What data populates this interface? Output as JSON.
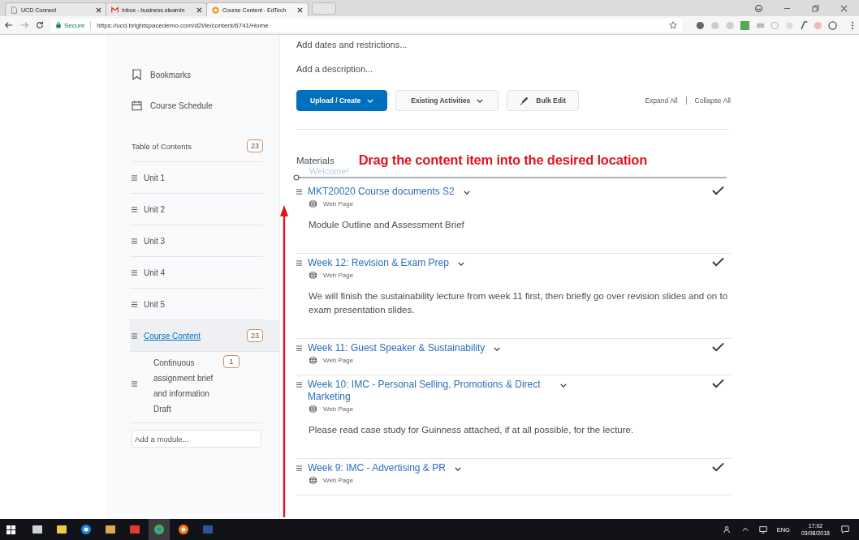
{
  "browser": {
    "tabs": [
      {
        "title": "UCD Connect",
        "kind": "page",
        "selected": false
      },
      {
        "title": "Inbox - business.elearnin",
        "kind": "mail",
        "selected": false
      },
      {
        "title": "Course Content - EdTech",
        "kind": "brightspace",
        "selected": true
      }
    ],
    "secure_label": "Secure",
    "url": "https://ucd.brightspacedemo.com/d2l/le/content/6741/Home"
  },
  "sidebar": {
    "nav": [
      {
        "label": "Bookmarks",
        "kind": "bookmark"
      },
      {
        "label": "Course Schedule",
        "kind": "schedule"
      }
    ],
    "toc": {
      "label": "Table of Contents",
      "count": "23"
    },
    "modules": [
      {
        "label": "Unit 1",
        "selected": false
      },
      {
        "label": "Unit 2",
        "selected": false
      },
      {
        "label": "Unit 3",
        "selected": false
      },
      {
        "label": "Unit 4",
        "selected": false
      },
      {
        "label": "Unit 5",
        "selected": false
      },
      {
        "label": "Course Content",
        "count": "23",
        "selected": true
      },
      {
        "label": "Continuous assignment brief and information Draft",
        "count": "1",
        "selected": false,
        "sub": true
      }
    ],
    "add_module": {
      "placeholder": "Add a module..."
    }
  },
  "main": {
    "dates_link": "Add dates and restrictions...",
    "description_link": "Add a description...",
    "buttons": [
      {
        "label": "Upload / Create",
        "kind": "primary"
      },
      {
        "label": "Existing Activities",
        "kind": "dropdown"
      },
      {
        "label": "Bulk Edit",
        "kind": "edit"
      }
    ],
    "expand_all": "Expand All",
    "collapse_all": "Collapse All",
    "materials_heading": "Materials",
    "annotation": "Drag the content item  into the desired location",
    "drag_ghost": "Welcome!",
    "items": [
      {
        "title": "MKT20020 Course documents S2",
        "type": "Web Page",
        "description": "Module Outline and Assessment Brief",
        "completed": true
      },
      {
        "title": "Week 12: Revision & Exam Prep",
        "type": "Web Page",
        "description": "We will finish the sustainability lecture from week 11 first, then briefly go over revision slides and on to exam presentation slides.",
        "completed": true
      },
      {
        "title": "Week 11: Guest Speaker & Sustainability",
        "type": "Web Page",
        "completed": true
      },
      {
        "title": "Week 10: IMC - Personal Selling, Promotions & Direct Marketing",
        "type": "Web Page",
        "description": "Please read case study for Guinness attached, if at all possible, for the lecture.",
        "completed": true
      },
      {
        "title": "Week 9: IMC - Advertising & PR",
        "type": "Web Page",
        "completed": true
      }
    ]
  },
  "taskbar": {
    "apps": [
      {
        "kind": "task-view",
        "selected": false
      },
      {
        "kind": "folder",
        "selected": false
      },
      {
        "kind": "edge",
        "selected": false
      },
      {
        "kind": "media",
        "selected": false
      },
      {
        "kind": "acrobat",
        "selected": false
      },
      {
        "kind": "chrome",
        "selected": true
      },
      {
        "kind": "firefox",
        "selected": false
      },
      {
        "kind": "word",
        "selected": false
      }
    ],
    "language": "ENG",
    "time": "17:02",
    "date": "03/08/2018"
  }
}
